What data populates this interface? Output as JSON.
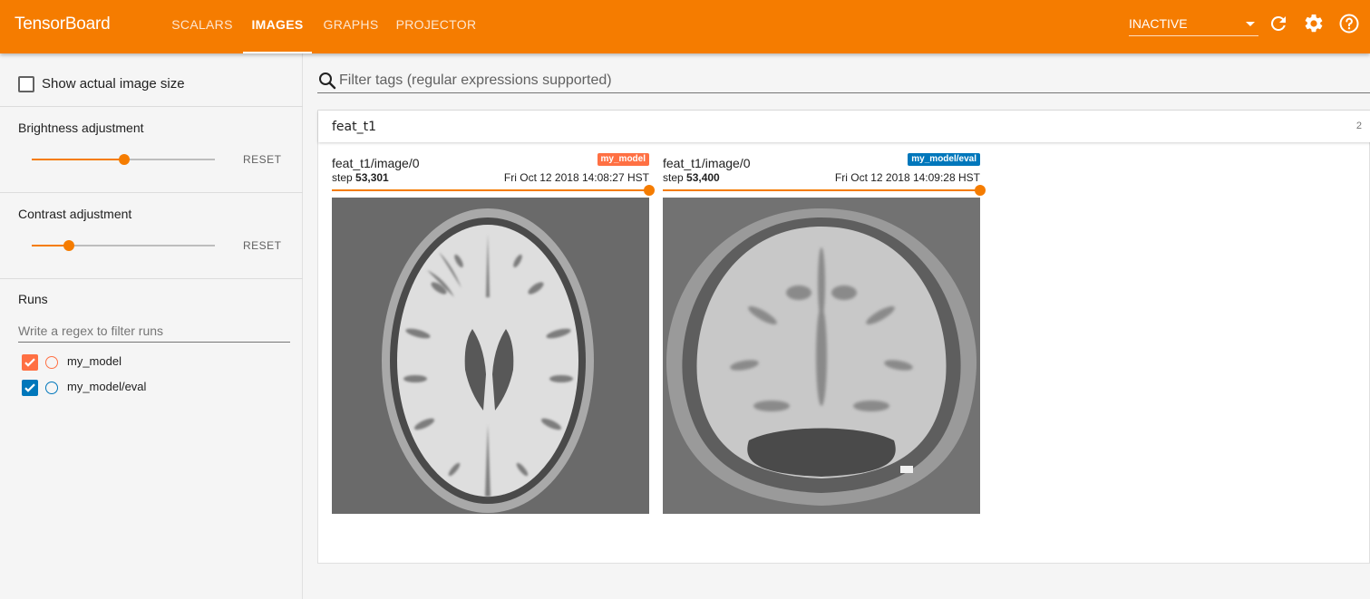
{
  "app": {
    "title": "TensorBoard"
  },
  "nav": {
    "tabs": [
      {
        "label": "SCALARS"
      },
      {
        "label": "IMAGES"
      },
      {
        "label": "GRAPHS"
      },
      {
        "label": "PROJECTOR"
      }
    ],
    "active_tab": "IMAGES",
    "status_select": "INACTIVE",
    "icons": [
      "refresh-icon",
      "settings-icon",
      "help-icon"
    ],
    "accent_color": "#f57c00"
  },
  "sidebar": {
    "show_actual_size": {
      "label": "Show actual image size",
      "checked": false
    },
    "brightness": {
      "label": "Brightness adjustment",
      "reset_label": "RESET",
      "value": 0.5
    },
    "contrast": {
      "label": "Contrast adjustment",
      "reset_label": "RESET",
      "value": 0.2
    },
    "runs": {
      "label": "Runs",
      "filter_placeholder": "Write a regex to filter runs",
      "items": [
        {
          "name": "my_model",
          "checked": true,
          "color": "#ff7043"
        },
        {
          "name": "my_model/eval",
          "checked": true,
          "color": "#0077bb"
        }
      ]
    }
  },
  "main": {
    "tag_filter_placeholder": "Filter tags (regular expressions supported)",
    "category": {
      "title": "feat_t1",
      "count": "2",
      "panes": [
        {
          "title": "feat_t1/image/0",
          "step_label": "step",
          "step": "53,301",
          "time": "Fri Oct 12 2018 14:08:27 HST",
          "run": "my_model",
          "run_color": "#ff7043",
          "image": "brain-mri-axial"
        },
        {
          "title": "feat_t1/image/0",
          "step_label": "step",
          "step": "53,400",
          "time": "Fri Oct 12 2018 14:09:28 HST",
          "run": "my_model/eval",
          "run_color": "#0077bb",
          "image": "brain-mri-coronal"
        }
      ]
    }
  }
}
